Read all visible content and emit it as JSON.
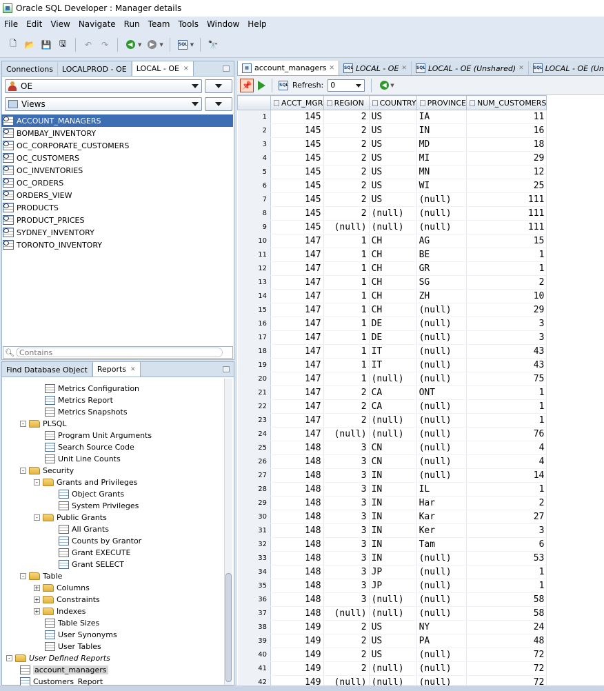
{
  "window": {
    "title": "Oracle SQL Developer : Manager details"
  },
  "menu": [
    "File",
    "Edit",
    "View",
    "Navigate",
    "Run",
    "Team",
    "Tools",
    "Window",
    "Help"
  ],
  "connections_panel": {
    "tabs": [
      {
        "label": "Connections"
      },
      {
        "label": "LOCALPROD - OE"
      },
      {
        "label": "LOCAL - OE"
      }
    ],
    "schema_selected": "OE",
    "object_type_selected": "Views",
    "views": [
      "ACCOUNT_MANAGERS",
      "BOMBAY_INVENTORY",
      "OC_CORPORATE_CUSTOMERS",
      "OC_CUSTOMERS",
      "OC_INVENTORIES",
      "OC_ORDERS",
      "ORDERS_VIEW",
      "PRODUCTS",
      "PRODUCT_PRICES",
      "SYDNEY_INVENTORY",
      "TORONTO_INVENTORY"
    ],
    "filter_placeholder": "Contains"
  },
  "reports_panel": {
    "tabs": [
      {
        "label": "Find Database Object"
      },
      {
        "label": "Reports"
      }
    ],
    "tree": [
      {
        "label": "Metrics Configuration",
        "level": 2,
        "kind": "report"
      },
      {
        "label": "Metrics Report",
        "level": 2,
        "kind": "report"
      },
      {
        "label": "Metrics Snapshots",
        "level": 2,
        "kind": "report"
      },
      {
        "label": "PLSQL",
        "level": 1,
        "kind": "folder",
        "expand": "-"
      },
      {
        "label": "Program Unit Arguments",
        "level": 2,
        "kind": "report"
      },
      {
        "label": "Search Source Code",
        "level": 2,
        "kind": "report"
      },
      {
        "label": "Unit Line Counts",
        "level": 2,
        "kind": "report"
      },
      {
        "label": "Security",
        "level": 1,
        "kind": "folder",
        "expand": "-"
      },
      {
        "label": "Grants and Privileges",
        "level": 2,
        "kind": "folder",
        "expand": "-"
      },
      {
        "label": "Object Grants",
        "level": 3,
        "kind": "report"
      },
      {
        "label": "System Privileges",
        "level": 3,
        "kind": "report"
      },
      {
        "label": "Public Grants",
        "level": 2,
        "kind": "folder",
        "expand": "-"
      },
      {
        "label": "All Grants",
        "level": 3,
        "kind": "report"
      },
      {
        "label": "Counts by Grantor",
        "level": 3,
        "kind": "report"
      },
      {
        "label": "Grant EXECUTE",
        "level": 3,
        "kind": "report"
      },
      {
        "label": "Grant SELECT",
        "level": 3,
        "kind": "report"
      },
      {
        "label": "Table",
        "level": 1,
        "kind": "folder",
        "expand": "-"
      },
      {
        "label": "Columns",
        "level": 2,
        "kind": "folder",
        "expand": "+"
      },
      {
        "label": "Constraints",
        "level": 2,
        "kind": "folder",
        "expand": "+"
      },
      {
        "label": "Indexes",
        "level": 2,
        "kind": "folder",
        "expand": "+"
      },
      {
        "label": "Table Sizes",
        "level": 2,
        "kind": "report"
      },
      {
        "label": "User Synonyms",
        "level": 2,
        "kind": "report"
      },
      {
        "label": "User Tables",
        "level": 2,
        "kind": "report"
      },
      {
        "label": "User Defined Reports",
        "level": 0,
        "kind": "folder",
        "expand": "-",
        "italic": true
      },
      {
        "label": "account_managers",
        "level": 1,
        "kind": "report",
        "selected": true
      },
      {
        "label": "Customers_Report",
        "level": 1,
        "kind": "report"
      }
    ]
  },
  "editor": {
    "tabs": [
      {
        "label": "account_managers",
        "active": true
      },
      {
        "label": "LOCAL - OE"
      },
      {
        "label": "LOCAL - OE (Unshared)"
      },
      {
        "label": "LOCAL - OE (Unshared)"
      }
    ],
    "refresh_label": "Refresh:",
    "refresh_value": "0",
    "columns": [
      "ACCT_MGR",
      "REGION",
      "COUNTRY",
      "PROVINCE",
      "NUM_CUSTOMERS"
    ],
    "rows": [
      [
        "145",
        "2",
        "US",
        "IA",
        "11"
      ],
      [
        "145",
        "2",
        "US",
        "IN",
        "16"
      ],
      [
        "145",
        "2",
        "US",
        "MD",
        "18"
      ],
      [
        "145",
        "2",
        "US",
        "MI",
        "29"
      ],
      [
        "145",
        "2",
        "US",
        "MN",
        "12"
      ],
      [
        "145",
        "2",
        "US",
        "WI",
        "25"
      ],
      [
        "145",
        "2",
        "US",
        "(null)",
        "111"
      ],
      [
        "145",
        "2",
        "(null)",
        "(null)",
        "111"
      ],
      [
        "145",
        "(null)",
        "(null)",
        "(null)",
        "111"
      ],
      [
        "147",
        "1",
        "CH",
        "AG",
        "15"
      ],
      [
        "147",
        "1",
        "CH",
        "BE",
        "1"
      ],
      [
        "147",
        "1",
        "CH",
        "GR",
        "1"
      ],
      [
        "147",
        "1",
        "CH",
        "SG",
        "2"
      ],
      [
        "147",
        "1",
        "CH",
        "ZH",
        "10"
      ],
      [
        "147",
        "1",
        "CH",
        "(null)",
        "29"
      ],
      [
        "147",
        "1",
        "DE",
        "(null)",
        "3"
      ],
      [
        "147",
        "1",
        "DE",
        "(null)",
        "3"
      ],
      [
        "147",
        "1",
        "IT",
        "(null)",
        "43"
      ],
      [
        "147",
        "1",
        "IT",
        "(null)",
        "43"
      ],
      [
        "147",
        "1",
        "(null)",
        "(null)",
        "75"
      ],
      [
        "147",
        "2",
        "CA",
        "ONT",
        "1"
      ],
      [
        "147",
        "2",
        "CA",
        "(null)",
        "1"
      ],
      [
        "147",
        "2",
        "(null)",
        "(null)",
        "1"
      ],
      [
        "147",
        "(null)",
        "(null)",
        "(null)",
        "76"
      ],
      [
        "148",
        "3",
        "CN",
        "(null)",
        "4"
      ],
      [
        "148",
        "3",
        "CN",
        "(null)",
        "4"
      ],
      [
        "148",
        "3",
        "IN",
        "(null)",
        "14"
      ],
      [
        "148",
        "3",
        "IN",
        "IL",
        "1"
      ],
      [
        "148",
        "3",
        "IN",
        "Har",
        "2"
      ],
      [
        "148",
        "3",
        "IN",
        "Kar",
        "27"
      ],
      [
        "148",
        "3",
        "IN",
        "Ker",
        "3"
      ],
      [
        "148",
        "3",
        "IN",
        "Tam",
        "6"
      ],
      [
        "148",
        "3",
        "IN",
        "(null)",
        "53"
      ],
      [
        "148",
        "3",
        "JP",
        "(null)",
        "1"
      ],
      [
        "148",
        "3",
        "JP",
        "(null)",
        "1"
      ],
      [
        "148",
        "3",
        "(null)",
        "(null)",
        "58"
      ],
      [
        "148",
        "(null)",
        "(null)",
        "(null)",
        "58"
      ],
      [
        "149",
        "2",
        "US",
        "NY",
        "24"
      ],
      [
        "149",
        "2",
        "US",
        "PA",
        "48"
      ],
      [
        "149",
        "2",
        "US",
        "(null)",
        "72"
      ],
      [
        "149",
        "2",
        "(null)",
        "(null)",
        "72"
      ],
      [
        "149",
        "(null)",
        "(null)",
        "(null)",
        "72"
      ]
    ]
  }
}
